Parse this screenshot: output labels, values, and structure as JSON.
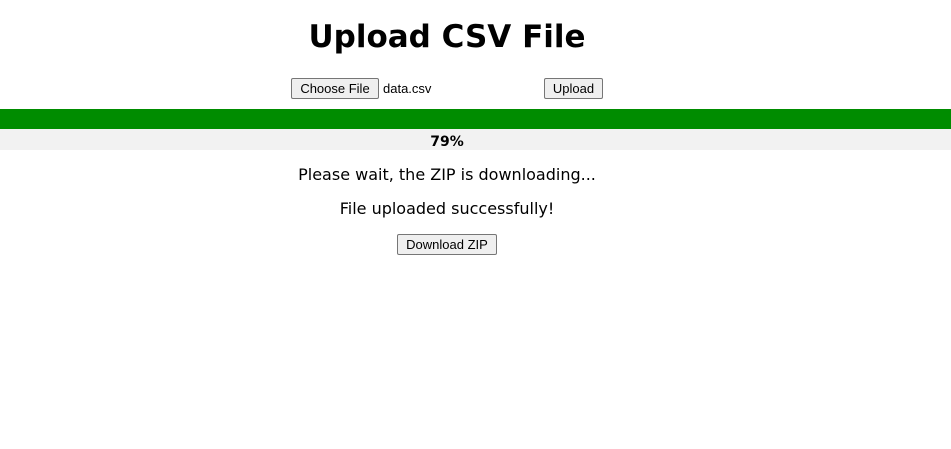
{
  "header": {
    "title": "Upload CSV File"
  },
  "upload_form": {
    "choose_file_label": "Choose File",
    "selected_file": "data.csv",
    "upload_label": "Upload"
  },
  "progress": {
    "percent": 79,
    "label": "79%",
    "bar_color": "#008c00",
    "track_color": "#f2f2f2"
  },
  "status": {
    "waiting_message": "Please wait, the ZIP is downloading...",
    "success_message": "File uploaded successfully!"
  },
  "actions": {
    "download_label": "Download ZIP"
  }
}
